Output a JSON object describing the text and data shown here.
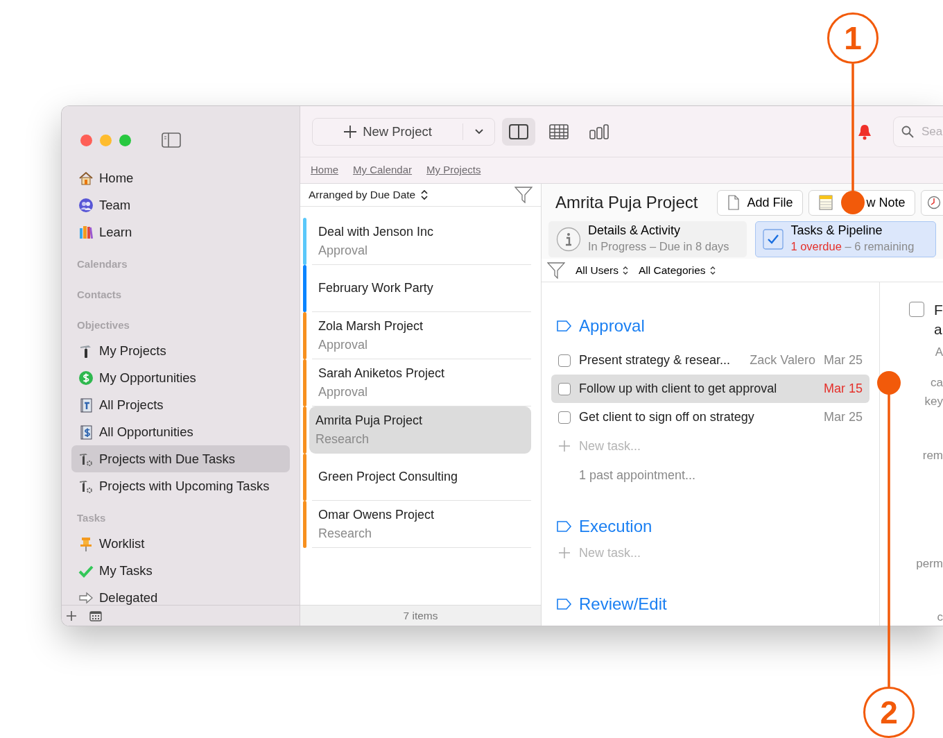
{
  "sidebar": {
    "items": [
      {
        "kind": "item",
        "label": "Home",
        "selected": false
      },
      {
        "kind": "item",
        "label": "Team",
        "selected": false
      },
      {
        "kind": "item",
        "label": "Learn",
        "selected": false
      },
      {
        "kind": "heading",
        "label": "Calendars"
      },
      {
        "kind": "heading",
        "label": "Contacts"
      },
      {
        "kind": "heading",
        "label": "Objectives"
      },
      {
        "kind": "item",
        "label": "My Projects",
        "selected": false
      },
      {
        "kind": "item",
        "label": "My Opportunities",
        "selected": false
      },
      {
        "kind": "item",
        "label": "All Projects",
        "selected": false
      },
      {
        "kind": "item",
        "label": "All Opportunities",
        "selected": false
      },
      {
        "kind": "item",
        "label": "Projects with Due Tasks",
        "selected": true
      },
      {
        "kind": "item",
        "label": "Projects with Upcoming Tasks",
        "selected": false
      },
      {
        "kind": "heading",
        "label": "Tasks"
      },
      {
        "kind": "item",
        "label": "Worklist",
        "selected": false
      },
      {
        "kind": "item",
        "label": "My Tasks",
        "selected": false
      },
      {
        "kind": "item",
        "label": "Delegated",
        "selected": false
      }
    ]
  },
  "toolbar": {
    "new_button": "New Project",
    "views": [
      {
        "selected": true
      },
      {
        "selected": false
      },
      {
        "selected": false
      }
    ],
    "search": {
      "placeholder": "Sea"
    }
  },
  "breadcrumbs": [
    "Home",
    "My Calendar",
    "My Projects"
  ],
  "project_list": {
    "sort_label": "Arranged by Due Date",
    "items": [
      {
        "title": "Deal with Jenson Inc",
        "subtitle": "Approval",
        "color": "#5ac8fa",
        "selected": false
      },
      {
        "title": "February Work Party",
        "color": "#0a84ff",
        "selected": false
      },
      {
        "title": "Zola Marsh Project",
        "subtitle": "Approval",
        "color": "#f7901e",
        "selected": false
      },
      {
        "title": "Sarah Aniketos Project",
        "subtitle": "Approval",
        "color": "#f7901e",
        "selected": false
      },
      {
        "title": "Amrita Puja Project",
        "subtitle": "Research",
        "color": "#f7901e",
        "selected": true
      },
      {
        "title": "Green Project Consulting",
        "color": "#f7901e",
        "selected": false
      },
      {
        "title": "Omar Owens Project",
        "subtitle": "Research",
        "color": "#f7901e",
        "selected": false
      }
    ],
    "footer": "7 items"
  },
  "detail": {
    "title": "Amrita Puja Project",
    "buttons": [
      "Add File",
      "w Note"
    ],
    "tabs": [
      {
        "title": "Details & Activity",
        "subtitle": "In Progress – Due in 8 days",
        "selected": false
      },
      {
        "title": "Tasks & Pipeline",
        "alert": "1 overdue",
        "subtitle": "– 6 remaining",
        "selected": true
      }
    ],
    "filters": [
      "All Users",
      "All Categories"
    ],
    "stages": [
      {
        "name": "Approval",
        "tasks": [
          {
            "title": "Present strategy & resear...",
            "assignee": "Zack Valero",
            "due": "Mar 25",
            "overdue": false,
            "checked": false,
            "selected": false
          },
          {
            "title": "Follow up with client to get approval",
            "due": "Mar 15",
            "overdue": true,
            "checked": false,
            "selected": true
          },
          {
            "title": "Get client to sign off on strategy",
            "due": "Mar 25",
            "overdue": false,
            "checked": false,
            "selected": false
          }
        ],
        "new_task": "New task...",
        "more": "1 past appointment..."
      },
      {
        "name": "Execution",
        "new_task": "New task..."
      },
      {
        "name": "Review/Edit"
      }
    ],
    "side_panel": {
      "checked": false,
      "title_lines": [
        "F",
        "a"
      ],
      "lines": [
        "A",
        "ca",
        "key",
        "rem",
        "perm",
        "c"
      ]
    }
  },
  "callouts": [
    "1",
    "2"
  ]
}
